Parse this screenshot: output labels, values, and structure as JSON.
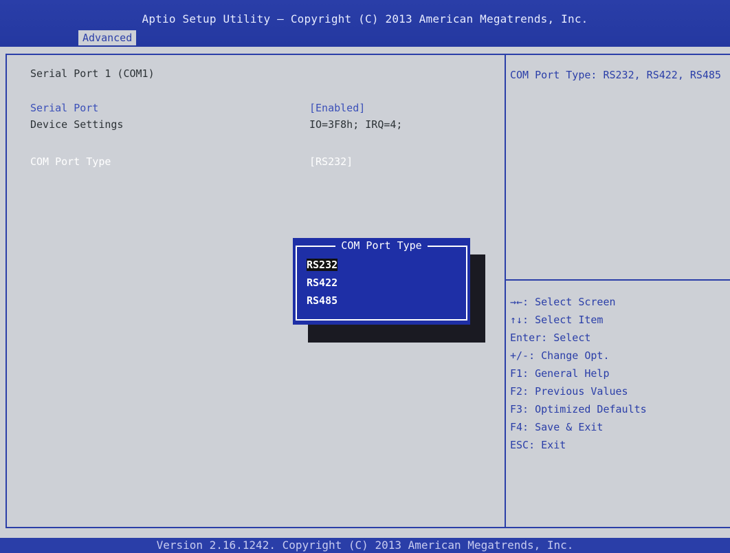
{
  "header": {
    "title": "Aptio Setup Utility – Copyright (C) 2013 American Megatrends, Inc.",
    "tab": "Advanced"
  },
  "left": {
    "section_title": "Serial Port 1 (COM1)",
    "settings": [
      {
        "label": "Serial Port",
        "value": "[Enabled]"
      },
      {
        "label": "Device Settings",
        "value": "IO=3F8h; IRQ=4;"
      },
      {
        "label": "COM Port Type",
        "value": "[RS232]"
      }
    ]
  },
  "help": {
    "text": "COM Port Type: RS232, RS422, RS485"
  },
  "keys": [
    "→←: Select Screen",
    "↑↓: Select Item",
    "Enter: Select",
    "+/-: Change Opt.",
    "F1: General Help",
    "F2: Previous Values",
    "F3: Optimized Defaults",
    "F4: Save & Exit",
    "ESC: Exit"
  ],
  "popup": {
    "title": "COM Port Type",
    "options": [
      "RS232",
      "RS422",
      "RS485"
    ],
    "selected": "RS232"
  },
  "footer": {
    "text": "Version 2.16.1242. Copyright (C) 2013 American Megatrends, Inc."
  },
  "colors": {
    "accent": "#2a3ea8",
    "background": "#cdd0d6",
    "popup": "#1e2fa6"
  }
}
